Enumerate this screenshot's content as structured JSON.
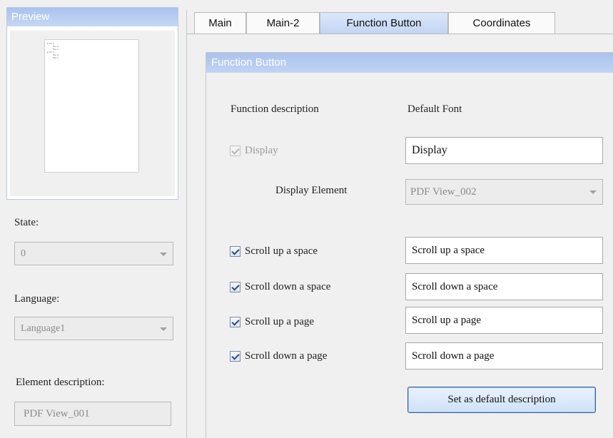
{
  "preview": {
    "title": "Preview",
    "tree_lines": [
      "▸ Dir 0",
      "File 0",
      "File 1",
      "▸ Dir 1",
      "File 0",
      "File 1"
    ]
  },
  "state": {
    "label": "State:",
    "value": "0"
  },
  "language": {
    "label": "Language:",
    "value": "Language1"
  },
  "element_description": {
    "label": "Element description:",
    "value": "PDF View_001"
  },
  "tabs": [
    {
      "label": "Main",
      "active": false
    },
    {
      "label": "Main-2",
      "active": false
    },
    {
      "label": "Function Button",
      "active": true
    },
    {
      "label": "Coordinates",
      "active": false
    }
  ],
  "function_button": {
    "title": "Function Button",
    "col_description": "Function description",
    "col_font": "Default Font",
    "display": {
      "label": "Display",
      "checked": true,
      "enabled": false,
      "text": "Display"
    },
    "display_element": {
      "label": "Display Element",
      "value": "PDF View_002"
    },
    "rows": [
      {
        "label": "Scroll up a space",
        "checked": true,
        "text": "Scroll up a space"
      },
      {
        "label": "Scroll down a space",
        "checked": true,
        "text": "Scroll down a space"
      },
      {
        "label": "Scroll up a page",
        "checked": true,
        "text": "Scroll up a page"
      },
      {
        "label": "Scroll down a page",
        "checked": true,
        "text": "Scroll down a page"
      }
    ],
    "set_default_label": "Set as default description"
  },
  "colors": {
    "header_gradient_top": "#a9c2ee",
    "header_gradient_bottom": "#c3d4f3",
    "active_tab": "#c4d5f2",
    "button_border": "#3c5f95"
  }
}
